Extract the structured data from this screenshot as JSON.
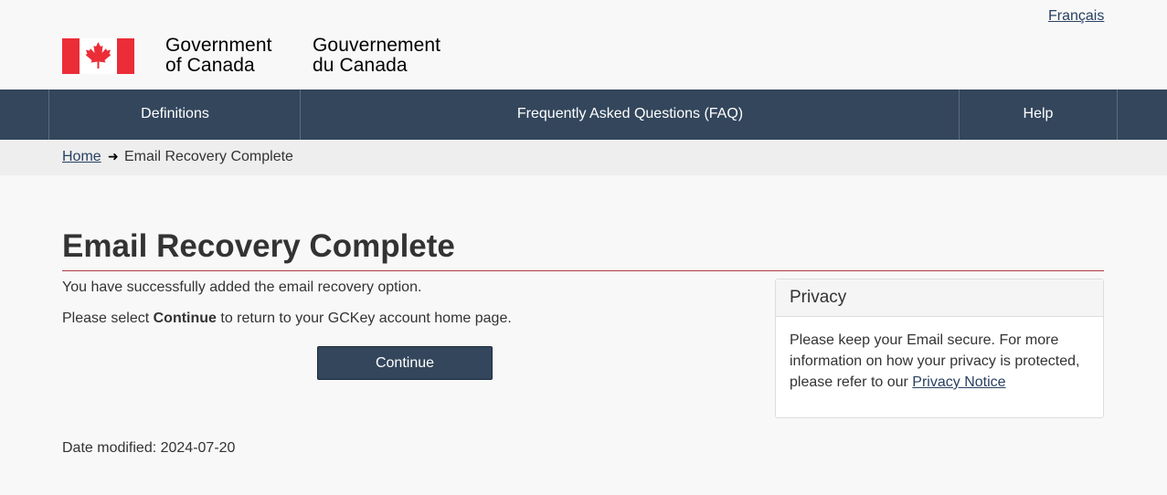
{
  "header": {
    "language_link": "Français",
    "signature_en": [
      "Government",
      "of Canada"
    ],
    "signature_fr": [
      "Gouvernement",
      "du Canada"
    ],
    "flag_icon": "canada-flag-icon"
  },
  "menu": {
    "items": [
      {
        "label": "Definitions"
      },
      {
        "label": "Frequently Asked Questions (FAQ)"
      },
      {
        "label": "Help"
      }
    ]
  },
  "breadcrumb": {
    "home": "Home",
    "separator_icon": "arrow-right-icon",
    "current": "Email Recovery Complete"
  },
  "main": {
    "title": "Email Recovery Complete",
    "message": "You have successfully added the email recovery option.",
    "instruction_prefix": "Please select ",
    "instruction_bold": "Continue",
    "instruction_suffix": " to return to your GCKey account home page.",
    "continue_label": "Continue"
  },
  "privacy": {
    "heading": "Privacy",
    "body": "Please keep your Email secure. For more information on how your privacy is protected, please refer to our ",
    "link": "Privacy Notice"
  },
  "footer": {
    "date_modified": "Date modified: 2024-07-20"
  },
  "colors": {
    "menu_bg": "#33465c",
    "link": "#284162",
    "title_rule": "#af3c43",
    "flag_red": "#eb2d37"
  }
}
